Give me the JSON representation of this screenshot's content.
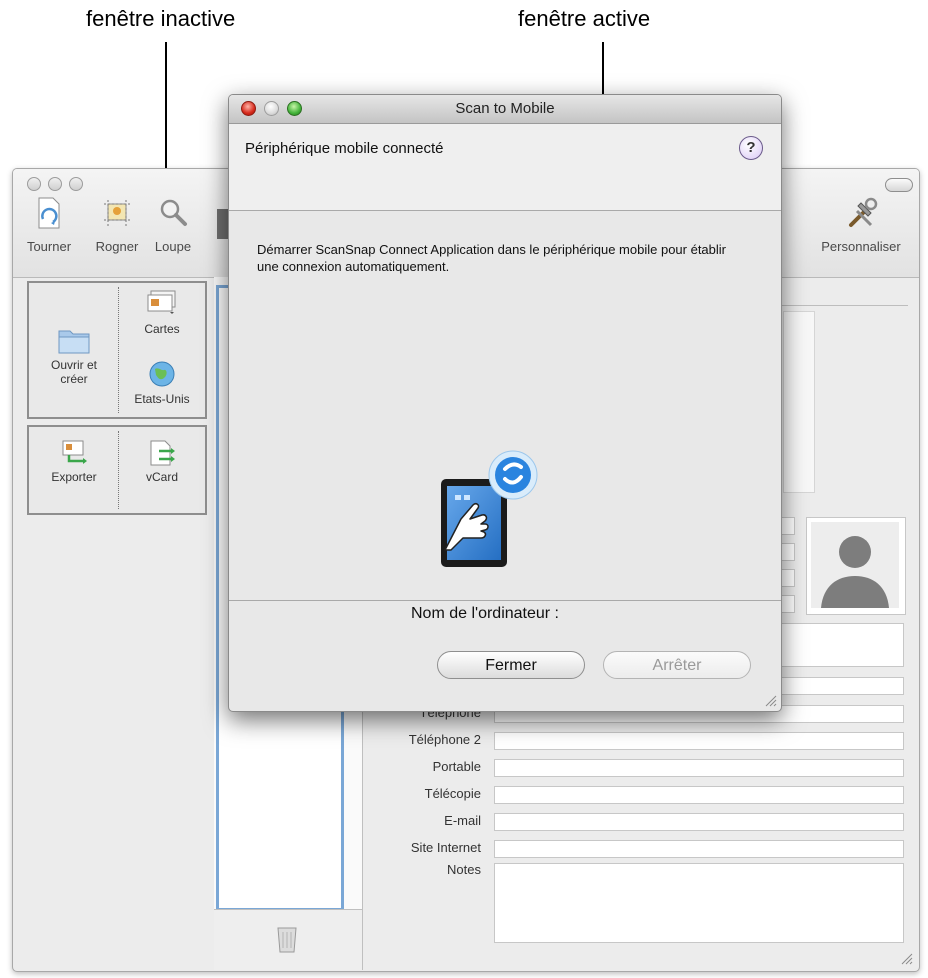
{
  "annotations": {
    "inactive_window_label": "fenêtre inactive",
    "active_window_label": "fenêtre active"
  },
  "back_window": {
    "toolbar": {
      "rotate_label": "Tourner",
      "crop_label": "Rogner",
      "zoom_label": "Loupe",
      "customize_label": "Personnaliser"
    },
    "actions": {
      "open_create_label": "Ouvrir et créer",
      "cards_label": "Cartes",
      "us_label": "Etats-Unis",
      "export_label": "Exporter",
      "vcard_label": "vCard"
    },
    "form_labels": {
      "phone": "Téléphone",
      "phone2": "Téléphone 2",
      "mobile": "Portable",
      "fax": "Télécopie",
      "email": "E-mail",
      "website": "Site Internet",
      "notes": "Notes"
    }
  },
  "dialog": {
    "title": "Scan to Mobile",
    "header": "Périphérique mobile connecté",
    "help_glyph": "?",
    "instructions": "Démarrer ScanSnap Connect Application dans le périphérique mobile pour établir une connexion automatiquement.",
    "computer_name_label": "Nom de l'ordinateur :",
    "close_button": "Fermer",
    "stop_button": "Arrêter",
    "icons": {
      "app": "tablet-tap-icon",
      "badge": "scansnap-s-icon"
    }
  }
}
